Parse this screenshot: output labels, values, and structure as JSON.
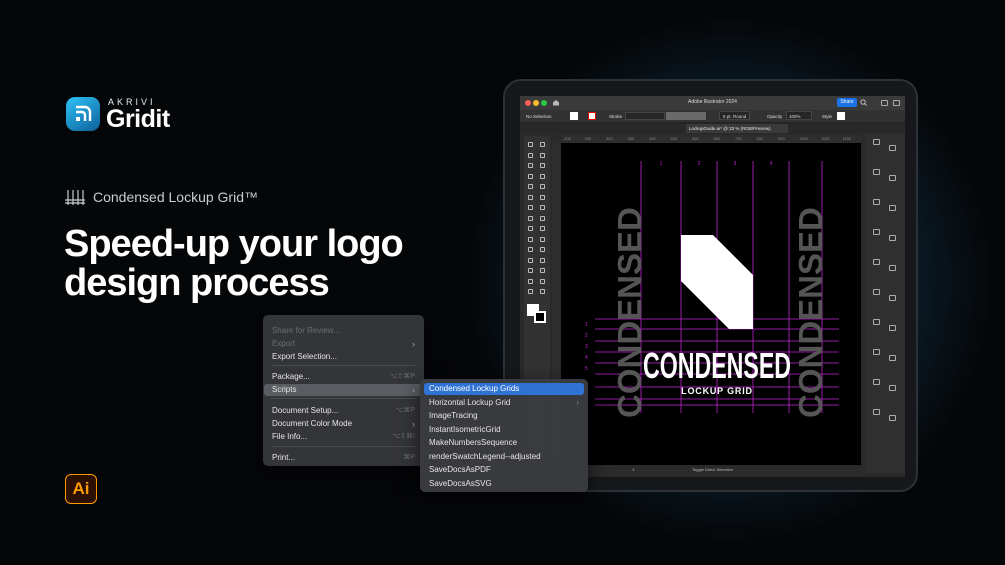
{
  "brand": {
    "tagline": "AKRIVI",
    "name": "Gridit"
  },
  "product": {
    "subtitle": "Condensed Lockup Grid™"
  },
  "headline": {
    "line1": "Speed-up your logo",
    "line2": "design process"
  },
  "app_badge": {
    "label": "Ai",
    "color": "#ff9a00"
  },
  "app": {
    "title": "Adobe Illustrator 2024",
    "share_label": "Share",
    "control_bar": {
      "selection": "No Selection",
      "stroke_label": "Stroke",
      "brush": "5 pt. Round",
      "opacity_label": "Opacity",
      "opacity_value": "100%",
      "style_label": "Style"
    },
    "document_tab": "LockupGuide.ai* @ 33 % (RGB/Preview)",
    "ruler_ticks": [
      "-100",
      "250",
      "300",
      "350",
      "400",
      "500",
      "550",
      "600",
      "700",
      "800",
      "900",
      "1000",
      "1100",
      "1150"
    ],
    "grid_columns": [
      "1",
      "2",
      "3",
      "4"
    ],
    "grid_rows": [
      "1",
      "2",
      "3",
      "4",
      "5"
    ],
    "artwork": {
      "wordmark": "CONDENSED",
      "tagline": "LOCKUP GRID",
      "side_text": "CONDENSED"
    },
    "status": {
      "page": "1",
      "mode": "Toggle Direct Selection"
    }
  },
  "file_menu": {
    "items": [
      {
        "label": "Share for Review...",
        "shortcut": "",
        "arrow": "",
        "dim": true
      },
      {
        "label": "Export",
        "shortcut": "",
        "arrow": "›",
        "dim": true
      },
      {
        "label": "Export Selection...",
        "shortcut": "",
        "arrow": "",
        "dim": false
      },
      {
        "label": "Package...",
        "shortcut": "⌥⇧⌘P",
        "arrow": "",
        "dim": false
      },
      {
        "label": "Scripts",
        "shortcut": "",
        "arrow": "›",
        "dim": false,
        "highlighted": true
      },
      {
        "label": "Document Setup...",
        "shortcut": "⌥⌘P",
        "arrow": "",
        "dim": false
      },
      {
        "label": "Document Color Mode",
        "shortcut": "",
        "arrow": "›",
        "dim": false
      },
      {
        "label": "File Info...",
        "shortcut": "⌥⇧⌘I",
        "arrow": "",
        "dim": false
      },
      {
        "label": "Print...",
        "shortcut": "⌘P",
        "arrow": "",
        "dim": false
      }
    ]
  },
  "scripts_menu": {
    "items": [
      {
        "label": "Condensed Lockup Grids",
        "highlighted": true,
        "arrow": ""
      },
      {
        "label": "Horizontal Lockup Grid",
        "arrow": "›"
      },
      {
        "label": "ImageTracing",
        "arrow": ""
      },
      {
        "label": "InstantIsometricGrid",
        "arrow": ""
      },
      {
        "label": "MakeNumbersSequence",
        "arrow": ""
      },
      {
        "label": "renderSwatchLegend--adjusted",
        "arrow": ""
      },
      {
        "label": "SaveDocsAsPDF",
        "arrow": ""
      },
      {
        "label": "SaveDocsAsSVG",
        "arrow": ""
      }
    ]
  },
  "colors": {
    "grid_magenta": "#c026d3",
    "highlight_blue": "#2f73d5",
    "accent_cyan": "#2ec3f5"
  }
}
